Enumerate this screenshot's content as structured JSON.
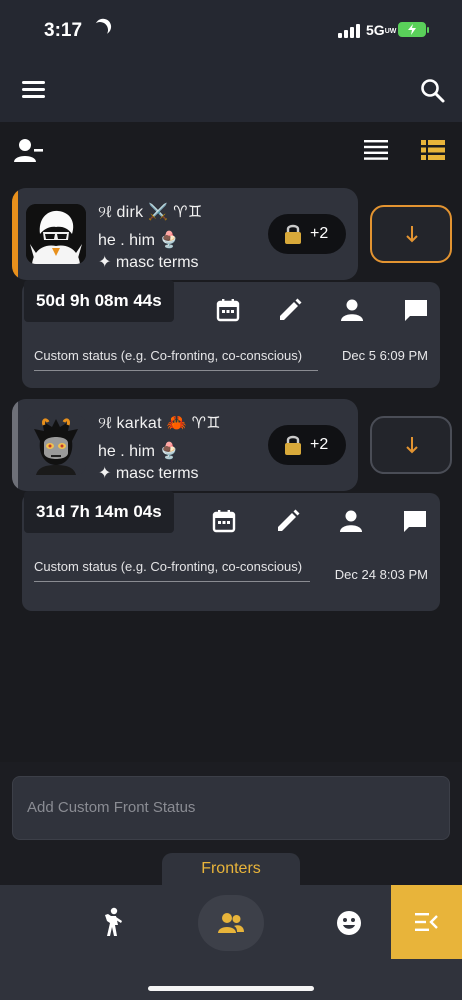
{
  "status_bar": {
    "time": "3:17",
    "network": "5G",
    "network_sub": "UW"
  },
  "toolbar": {
    "add_member_icon": "person-add-icon",
    "list_view_icon": "list-view-icon",
    "detail_view_icon": "detail-list-icon"
  },
  "fronters": [
    {
      "name": "୨ℓ dirk ⚔️ ♈︎♊︎",
      "pronouns": "he . him 🍨",
      "terms": "✦ masc terms",
      "extra_count": "+2",
      "timer": "50d 9h 08m 44s",
      "status_placeholder": "Custom status (e.g. Co-fronting, co-conscious)",
      "date": "Dec 5 6:09 PM",
      "accent": "#e8901c"
    },
    {
      "name": "୨ℓ karkat 🦀 ♈︎♊︎",
      "pronouns": "he . him 🍨",
      "terms": "✦ masc terms",
      "extra_count": "+2",
      "timer": "31d 7h 14m 04s",
      "status_placeholder": "Custom status (e.g. Co-fronting, co-conscious)",
      "date": "Dec 24 8:03 PM",
      "accent": "#6e7078"
    }
  ],
  "custom_front": {
    "placeholder": "Add Custom Front Status"
  },
  "tabs": {
    "fronters": "Fronters"
  },
  "colors": {
    "accent": "#e8b43a",
    "orange": "#e39431",
    "surface": "#30333c",
    "background": "#1a1b1f"
  }
}
